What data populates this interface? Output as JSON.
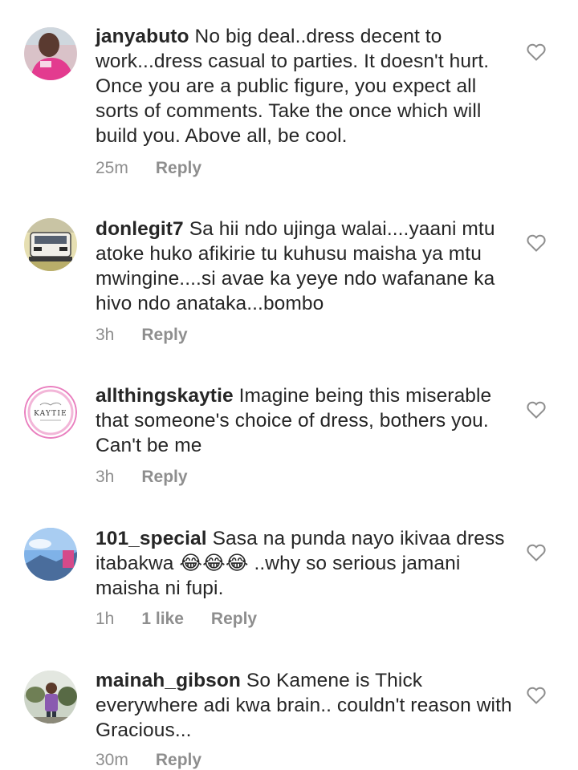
{
  "colors": {
    "text": "#262626",
    "meta": "#8e8e8e",
    "heart_stroke": "#8e8e8e"
  },
  "comments": [
    {
      "username": "janyabuto",
      "text": "No big deal..dress decent to work...dress casual to parties. It doesn't hurt. Once you are a public figure, you expect all sorts of comments. Take the once which will build you. Above all, be cool.",
      "time": "25m",
      "likes": "",
      "reply": "Reply",
      "avatar_icon": "avatar-photo-pink"
    },
    {
      "username": "donlegit7",
      "text": "Sa hii ndo ujinga walai....yaani mtu atoke huko afikirie tu kuhusu maisha ya mtu mwingine....si avae ka yeye ndo wafanane ka hivo ndo anataka...bombo",
      "time": "3h",
      "likes": "",
      "reply": "Reply",
      "avatar_icon": "avatar-photo-vehicle"
    },
    {
      "username": "allthingskaytie",
      "text": "Imagine being this miserable that someone's choice of dress, bothers you. Can't be me",
      "time": "3h",
      "likes": "",
      "reply": "Reply",
      "avatar_icon": "avatar-logo-kaytie",
      "avatar_logo_text": "KAYTIE"
    },
    {
      "username": "101_special",
      "text": "Sasa na punda nayo ikivaa dress itabakwa 😂😂😂 ..why so serious jamani maisha ni fupi.",
      "time": "1h",
      "likes": "1 like",
      "reply": "Reply",
      "avatar_icon": "avatar-photo-sky"
    },
    {
      "username": "mainah_gibson",
      "text": "So Kamene is Thick everywhere adi kwa brain.. couldn't reason with Gracious...",
      "time": "30m",
      "likes": "",
      "reply": "Reply",
      "avatar_icon": "avatar-photo-outdoor"
    }
  ]
}
